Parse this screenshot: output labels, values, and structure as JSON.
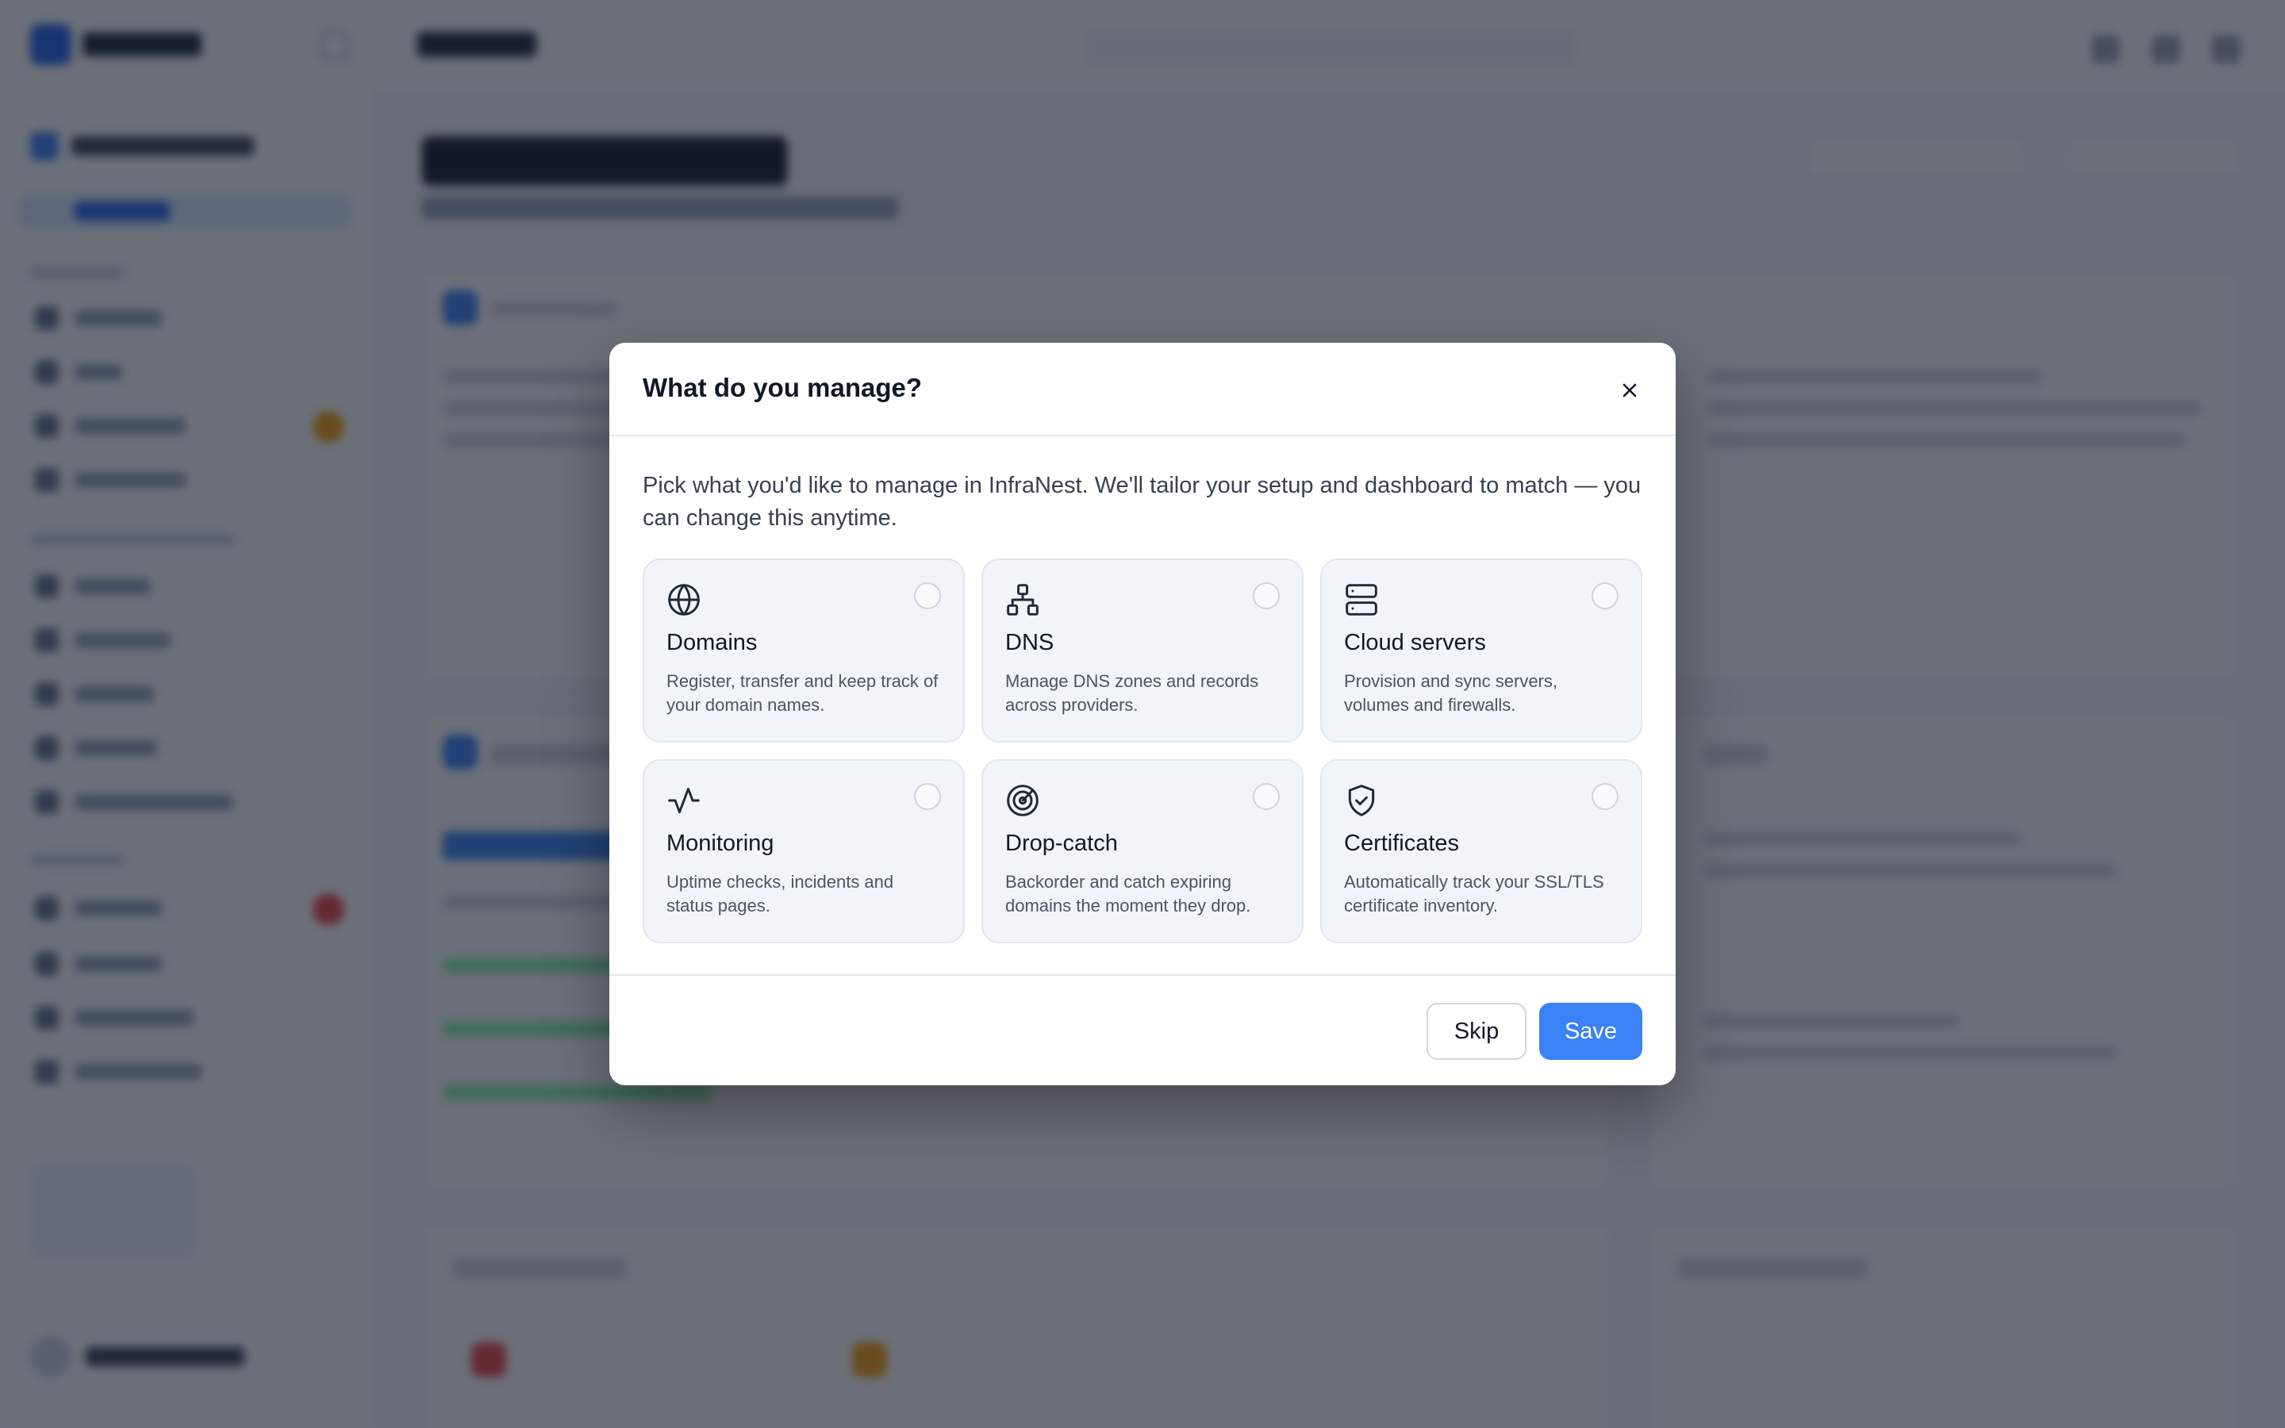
{
  "modal": {
    "title": "What do you manage?",
    "intro": "Pick what you'd like to manage in InfraNest. We'll tailor your setup and dashboard to match — you can change this anytime.",
    "options": [
      {
        "title": "Domains",
        "description": "Register, transfer and keep track of your domain names.",
        "icon": "globe-icon",
        "selected": false
      },
      {
        "title": "DNS",
        "description": "Manage DNS zones and records across providers.",
        "icon": "network-icon",
        "selected": false
      },
      {
        "title": "Cloud servers",
        "description": "Provision and sync servers, volumes and firewalls.",
        "icon": "server-icon",
        "selected": false
      },
      {
        "title": "Monitoring",
        "description": "Uptime checks, incidents and status pages.",
        "icon": "activity-icon",
        "selected": false
      },
      {
        "title": "Drop-catch",
        "description": "Backorder and catch expiring domains the moment they drop.",
        "icon": "radar-icon",
        "selected": false
      },
      {
        "title": "Certificates",
        "description": "Automatically track your SSL/TLS certificate inventory.",
        "icon": "shield-check-icon",
        "selected": false
      }
    ],
    "buttons": {
      "skip": "Skip",
      "save": "Save"
    }
  },
  "colors": {
    "primary": "#3b82f6",
    "overlay": "rgba(17, 24, 39, 0.62)",
    "card_bg": "#f1f4f8",
    "warning": "#f59e0b",
    "danger": "#ef4444"
  }
}
